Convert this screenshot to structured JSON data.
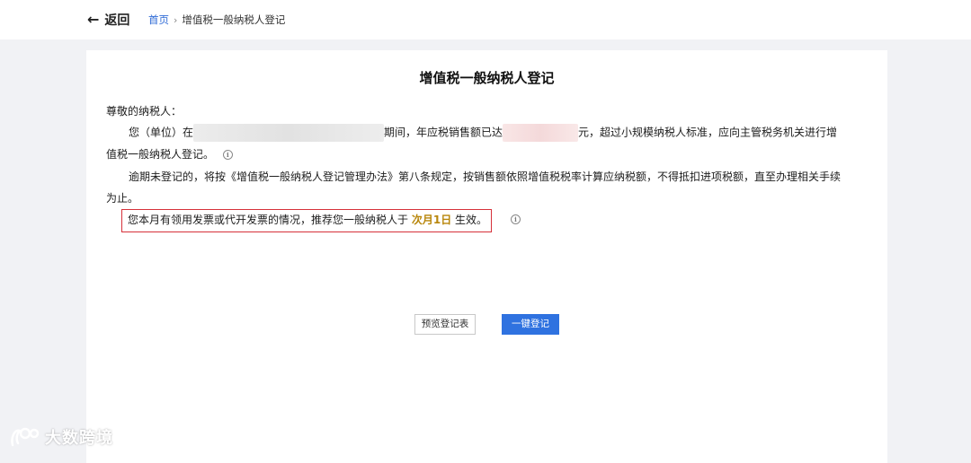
{
  "header": {
    "back_arrow": "←",
    "back_label": "返回",
    "breadcrumb_home": "首页",
    "breadcrumb_sep": "›",
    "breadcrumb_current": "增值税一般纳税人登记"
  },
  "doc": {
    "title": "增值税一般纳税人登记",
    "greeting": "尊敬的纳税人：",
    "line1_prefix": "您（单位）在",
    "line1_mid": "期间，年应税销售额已达",
    "line1_suffix": "元，超过小规模纳税人标准，应向主管税务机关进行增",
    "line2": "值税一般纳税人登记。",
    "line3": "逾期未登记的，将按《增值税一般纳税人登记管理办法》第八条规定，按销售额依照增值税税率计算应纳税额，不得抵扣进项税额，直至办理相关手续",
    "line4": "为止。",
    "notice_prefix": "您本月有领用发票或代开发票的情况，推荐您一般纳税人于",
    "notice_highlight": "次月1日",
    "notice_suffix": "生效。",
    "info_glyph": "i"
  },
  "actions": {
    "preview_label": "预览登记表",
    "register_label": "一键登记"
  },
  "watermark": {
    "text": "大数跨境"
  },
  "colors": {
    "link": "#2f6bd6",
    "primary": "#2f72e0",
    "notice_border": "#d6313a",
    "highlight": "#b8860b"
  }
}
